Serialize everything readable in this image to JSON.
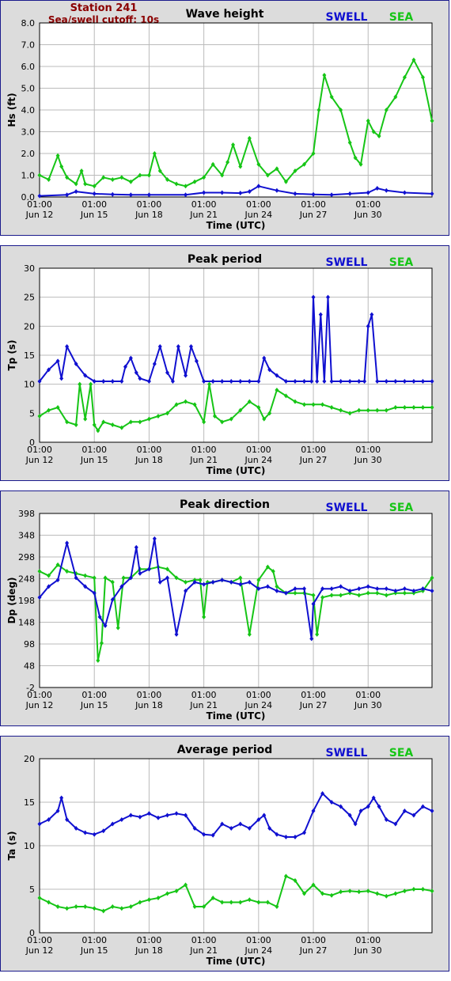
{
  "station": {
    "name": "Station 241",
    "cutoff": "Sea/swell cutoff: 10s",
    "color": "#8b0000"
  },
  "colors": {
    "swell": "#1010d0",
    "sea": "#16c516",
    "plot_bg": "#ffffff",
    "panel_bg": "#dcdcdc"
  },
  "legend": {
    "swell": "SWELL",
    "sea": "SEA"
  },
  "x_axis": {
    "label": "Time (UTC)",
    "range_days": [
      0,
      21.5
    ],
    "ticks": [
      {
        "day": 0,
        "time": "01:00",
        "date": "Jun 12"
      },
      {
        "day": 3,
        "time": "01:00",
        "date": "Jun 15"
      },
      {
        "day": 6,
        "time": "01:00",
        "date": "Jun 18"
      },
      {
        "day": 9,
        "time": "01:00",
        "date": "Jun 21"
      },
      {
        "day": 12,
        "time": "01:00",
        "date": "Jun 24"
      },
      {
        "day": 15,
        "time": "01:00",
        "date": "Jun 27"
      },
      {
        "day": 18,
        "time": "01:00",
        "date": "Jun 30"
      }
    ]
  },
  "chart_data": [
    {
      "type": "line",
      "title": "Wave height",
      "ylabel": "Hs (ft)",
      "ylim": [
        0,
        8
      ],
      "yticks": [
        "0.0",
        "1.0",
        "2.0",
        "3.0",
        "4.0",
        "5.0",
        "6.0",
        "7.0",
        "8.0"
      ],
      "ytick_values": [
        0,
        1,
        2,
        3,
        4,
        5,
        6,
        7,
        8
      ],
      "grid": true,
      "series": [
        {
          "name": "SWELL",
          "x": [
            0,
            1.5,
            2,
            3,
            4,
            5,
            6,
            8,
            9,
            10,
            11,
            11.5,
            12,
            13,
            14,
            15,
            16,
            17,
            18,
            18.5,
            19,
            20,
            21.5
          ],
          "y": [
            0.05,
            0.1,
            0.25,
            0.15,
            0.12,
            0.1,
            0.1,
            0.1,
            0.2,
            0.2,
            0.18,
            0.25,
            0.5,
            0.3,
            0.15,
            0.12,
            0.1,
            0.15,
            0.2,
            0.4,
            0.3,
            0.2,
            0.15
          ]
        },
        {
          "name": "SEA",
          "x": [
            0,
            0.5,
            1,
            1.2,
            1.5,
            2,
            2.3,
            2.5,
            3,
            3.5,
            4,
            4.5,
            5,
            5.5,
            6,
            6.3,
            6.6,
            7,
            7.5,
            8,
            8.5,
            9,
            9.5,
            10,
            10.3,
            10.6,
            11,
            11.5,
            12,
            12.5,
            13,
            13.5,
            14,
            14.5,
            15,
            15.3,
            15.6,
            16,
            16.5,
            17,
            17.3,
            17.6,
            18,
            18.3,
            18.6,
            19,
            19.5,
            20,
            20.5,
            21,
            21.5
          ],
          "y": [
            1.0,
            0.8,
            1.9,
            1.4,
            0.9,
            0.6,
            1.2,
            0.6,
            0.5,
            0.9,
            0.8,
            0.9,
            0.7,
            1.0,
            1.0,
            2.0,
            1.2,
            0.8,
            0.6,
            0.5,
            0.7,
            0.9,
            1.5,
            1.0,
            1.6,
            2.4,
            1.4,
            2.7,
            1.5,
            1.0,
            1.3,
            0.7,
            1.2,
            1.5,
            2.0,
            4.0,
            5.6,
            4.6,
            4.0,
            2.5,
            1.8,
            1.5,
            3.5,
            3.0,
            2.8,
            4.0,
            4.6,
            5.5,
            6.3,
            5.5,
            3.5
          ]
        }
      ]
    },
    {
      "type": "scatter",
      "title": "Peak period",
      "ylabel": "Tp (s)",
      "ylim": [
        0,
        30
      ],
      "yticks": [
        "0",
        "5",
        "10",
        "15",
        "20",
        "25",
        "30"
      ],
      "ytick_values": [
        0,
        5,
        10,
        15,
        20,
        25,
        30
      ],
      "grid": true,
      "series": [
        {
          "name": "SWELL",
          "x": [
            0,
            0.5,
            1,
            1.2,
            1.5,
            2,
            2.5,
            3,
            3.5,
            4,
            4.5,
            4.7,
            5,
            5.3,
            5.5,
            6,
            6.3,
            6.6,
            7,
            7.3,
            7.6,
            8,
            8.3,
            8.6,
            9,
            9.5,
            10,
            10.5,
            11,
            11.5,
            12,
            12.3,
            12.6,
            13,
            13.5,
            14,
            14.5,
            14.9,
            15,
            15.2,
            15.4,
            15.6,
            15.8,
            16,
            16.5,
            17,
            17.5,
            17.8,
            18,
            18.2,
            18.5,
            19,
            19.5,
            20,
            20.5,
            21,
            21.5
          ],
          "y": [
            10.5,
            12.5,
            14,
            11,
            16.5,
            13.5,
            11.5,
            10.5,
            10.5,
            10.5,
            10.5,
            13,
            14.5,
            12,
            11,
            10.5,
            13.5,
            16.5,
            12,
            10.5,
            16.5,
            11.5,
            16.5,
            14,
            10.5,
            10.5,
            10.5,
            10.5,
            10.5,
            10.5,
            10.5,
            14.5,
            12.5,
            11.5,
            10.5,
            10.5,
            10.5,
            10.5,
            25,
            10.5,
            22,
            10.5,
            25,
            10.5,
            10.5,
            10.5,
            10.5,
            10.5,
            20,
            22,
            10.5,
            10.5,
            10.5,
            10.5,
            10.5,
            10.5,
            10.5
          ]
        },
        {
          "name": "SEA",
          "x": [
            0,
            0.5,
            1,
            1.5,
            2,
            2.2,
            2.5,
            2.8,
            3,
            3.2,
            3.5,
            4,
            4.5,
            5,
            5.5,
            6,
            6.5,
            7,
            7.5,
            8,
            8.5,
            9,
            9.3,
            9.6,
            10,
            10.5,
            11,
            11.5,
            12,
            12.3,
            12.6,
            13,
            13.5,
            14,
            14.5,
            15,
            15.5,
            16,
            16.5,
            17,
            17.5,
            18,
            18.5,
            19,
            19.5,
            20,
            20.5,
            21,
            21.5
          ],
          "y": [
            4.5,
            5.5,
            6,
            3.5,
            3,
            10,
            4,
            10,
            3,
            2,
            3.5,
            3,
            2.5,
            3.5,
            3.5,
            4,
            4.5,
            5,
            6.5,
            7,
            6.5,
            3.5,
            10,
            4.5,
            3.5,
            4,
            5.5,
            7,
            6,
            4,
            5,
            9,
            8,
            7,
            6.5,
            6.5,
            6.5,
            6,
            5.5,
            5,
            5.5,
            5.5,
            5.5,
            5.5,
            6,
            6,
            6,
            6,
            6
          ]
        }
      ]
    },
    {
      "type": "line",
      "title": "Peak direction",
      "ylabel": "Dp (deg)",
      "ylim": [
        -2,
        398
      ],
      "yticks": [
        "-2",
        "48",
        "98",
        "148",
        "198",
        "248",
        "298",
        "348",
        "398"
      ],
      "ytick_values": [
        -2,
        48,
        98,
        148,
        198,
        248,
        298,
        348,
        398
      ],
      "grid": true,
      "series": [
        {
          "name": "SWELL",
          "x": [
            0,
            0.5,
            1,
            1.5,
            2,
            2.5,
            3,
            3.3,
            3.6,
            4,
            4.5,
            5,
            5.3,
            5.5,
            6,
            6.3,
            6.6,
            7,
            7.5,
            8,
            8.5,
            9,
            9.5,
            10,
            10.5,
            11,
            11.5,
            12,
            12.5,
            13,
            13.5,
            14,
            14.5,
            14.9,
            15,
            15.5,
            16,
            16.5,
            17,
            17.5,
            18,
            18.5,
            19,
            19.5,
            20,
            20.5,
            21,
            21.5
          ],
          "y": [
            205,
            230,
            245,
            330,
            250,
            230,
            215,
            160,
            140,
            200,
            230,
            250,
            320,
            260,
            270,
            340,
            240,
            250,
            120,
            220,
            240,
            235,
            240,
            245,
            240,
            235,
            240,
            225,
            230,
            220,
            215,
            225,
            225,
            110,
            190,
            225,
            225,
            230,
            220,
            225,
            230,
            225,
            225,
            220,
            225,
            220,
            225,
            220
          ]
        },
        {
          "name": "SEA",
          "x": [
            0,
            0.5,
            1,
            1.5,
            2,
            2.5,
            3,
            3.2,
            3.4,
            3.6,
            4,
            4.3,
            4.6,
            5,
            5.5,
            6,
            6.5,
            7,
            7.5,
            8,
            8.5,
            8.8,
            9,
            9.2,
            9.5,
            10,
            10.5,
            11,
            11.5,
            12,
            12.5,
            12.8,
            13,
            13.5,
            14,
            14.5,
            15,
            15.2,
            15.5,
            16,
            16.5,
            17,
            17.5,
            18,
            18.5,
            19,
            19.5,
            20,
            20.5,
            21,
            21.5
          ],
          "y": [
            265,
            255,
            280,
            265,
            260,
            255,
            250,
            60,
            100,
            250,
            240,
            135,
            250,
            250,
            270,
            270,
            275,
            270,
            250,
            240,
            245,
            245,
            160,
            240,
            240,
            245,
            240,
            250,
            120,
            245,
            275,
            265,
            230,
            215,
            215,
            215,
            210,
            120,
            205,
            210,
            210,
            215,
            210,
            215,
            215,
            210,
            215,
            215,
            215,
            220,
            250
          ]
        }
      ]
    },
    {
      "type": "line",
      "title": "Average period",
      "ylabel": "Ta (s)",
      "ylim": [
        0,
        20
      ],
      "yticks": [
        "0",
        "5",
        "10",
        "15",
        "20"
      ],
      "ytick_values": [
        0,
        5,
        10,
        15,
        20
      ],
      "grid": true,
      "series": [
        {
          "name": "SWELL",
          "x": [
            0,
            0.5,
            1,
            1.2,
            1.5,
            2,
            2.5,
            3,
            3.5,
            4,
            4.5,
            5,
            5.5,
            6,
            6.5,
            7,
            7.5,
            8,
            8.5,
            9,
            9.5,
            10,
            10.5,
            11,
            11.5,
            12,
            12.3,
            12.6,
            13,
            13.5,
            14,
            14.5,
            15,
            15.5,
            16,
            16.5,
            17,
            17.3,
            17.6,
            18,
            18.3,
            18.6,
            19,
            19.5,
            20,
            20.5,
            21,
            21.5
          ],
          "y": [
            12.5,
            13,
            14,
            15.5,
            13,
            12,
            11.5,
            11.3,
            11.7,
            12.5,
            13,
            13.5,
            13.3,
            13.7,
            13.2,
            13.5,
            13.7,
            13.5,
            12,
            11.3,
            11.2,
            12.5,
            12,
            12.5,
            12,
            13,
            13.5,
            12,
            11.3,
            11,
            11,
            11.5,
            14,
            16,
            15,
            14.5,
            13.5,
            12.5,
            14,
            14.5,
            15.5,
            14.5,
            13,
            12.5,
            14,
            13.5,
            14.5,
            14
          ]
        },
        {
          "name": "SEA",
          "x": [
            0,
            0.5,
            1,
            1.5,
            2,
            2.5,
            3,
            3.5,
            4,
            4.5,
            5,
            5.5,
            6,
            6.5,
            7,
            7.5,
            8,
            8.5,
            9,
            9.5,
            10,
            10.5,
            11,
            11.5,
            12,
            12.5,
            13,
            13.5,
            14,
            14.5,
            15,
            15.5,
            16,
            16.5,
            17,
            17.5,
            18,
            18.5,
            19,
            19.5,
            20,
            20.5,
            21,
            21.5
          ],
          "y": [
            4,
            3.5,
            3,
            2.8,
            3,
            3,
            2.8,
            2.5,
            3,
            2.8,
            3,
            3.5,
            3.8,
            4,
            4.5,
            4.8,
            5.5,
            3,
            3,
            4,
            3.5,
            3.5,
            3.5,
            3.8,
            3.5,
            3.5,
            3,
            6.5,
            6,
            4.5,
            5.5,
            4.5,
            4.3,
            4.7,
            4.8,
            4.7,
            4.8,
            4.5,
            4.2,
            4.5,
            4.8,
            5,
            5,
            4.8
          ]
        }
      ]
    }
  ]
}
